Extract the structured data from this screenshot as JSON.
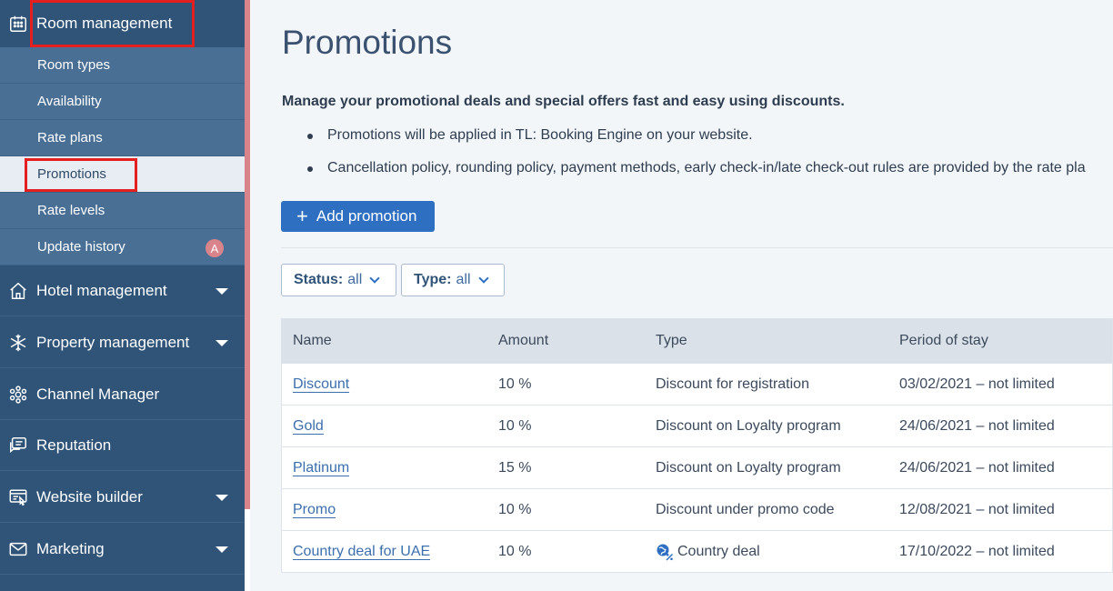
{
  "sidebar": {
    "room_management": "Room management",
    "sub_items": [
      {
        "label": "Room types"
      },
      {
        "label": "Availability"
      },
      {
        "label": "Rate plans"
      },
      {
        "label": "Promotions"
      },
      {
        "label": "Rate levels"
      },
      {
        "label": "Update history",
        "badge": "A"
      }
    ],
    "items": [
      {
        "label": "Hotel management",
        "icon": "house-icon",
        "expandable": true
      },
      {
        "label": "Property management",
        "icon": "snowflake-icon",
        "expandable": true
      },
      {
        "label": "Channel Manager",
        "icon": "hub-icon",
        "expandable": false
      },
      {
        "label": "Reputation",
        "icon": "chat-icon",
        "expandable": false
      },
      {
        "label": "Website builder",
        "icon": "website-icon",
        "expandable": true
      },
      {
        "label": "Marketing",
        "icon": "envelope-icon",
        "expandable": true
      }
    ]
  },
  "page": {
    "title": "Promotions",
    "description": "Manage your promotional deals and special offers fast and easy using discounts.",
    "bullets": [
      "Promotions will be applied in TL: Booking Engine on your website.",
      "Cancellation policy, rounding policy, payment methods, early check-in/late check-out rules are provided by the rate pla"
    ],
    "add_button": "Add promotion"
  },
  "filters": {
    "status_label": "Status:",
    "status_value": "all",
    "type_label": "Type:",
    "type_value": "all"
  },
  "table": {
    "headers": [
      "Name",
      "Amount",
      "Type",
      "Period of stay"
    ],
    "rows": [
      {
        "name": "Discount",
        "amount": "10 %",
        "type": "Discount for registration",
        "period": "03/02/2021 – not limited"
      },
      {
        "name": "Gold",
        "amount": "10 %",
        "type": "Discount on Loyalty program",
        "period": "24/06/2021 – not limited"
      },
      {
        "name": "Platinum",
        "amount": "15 %",
        "type": "Discount on Loyalty program",
        "period": "24/06/2021 – not limited"
      },
      {
        "name": "Promo",
        "amount": "10 %",
        "type": "Discount under promo code",
        "period": "12/08/2021 – not limited"
      },
      {
        "name": "Country deal for UAE",
        "amount": "10 %",
        "type": "Country deal",
        "type_icon": "globe-percent-icon",
        "period": "17/10/2022 – not limited"
      }
    ]
  },
  "colors": {
    "sidebar_bg": "#2f5478",
    "submenu_bg": "#4a6f95",
    "accent": "#2f6fc1",
    "highlight": "#e3201f"
  }
}
